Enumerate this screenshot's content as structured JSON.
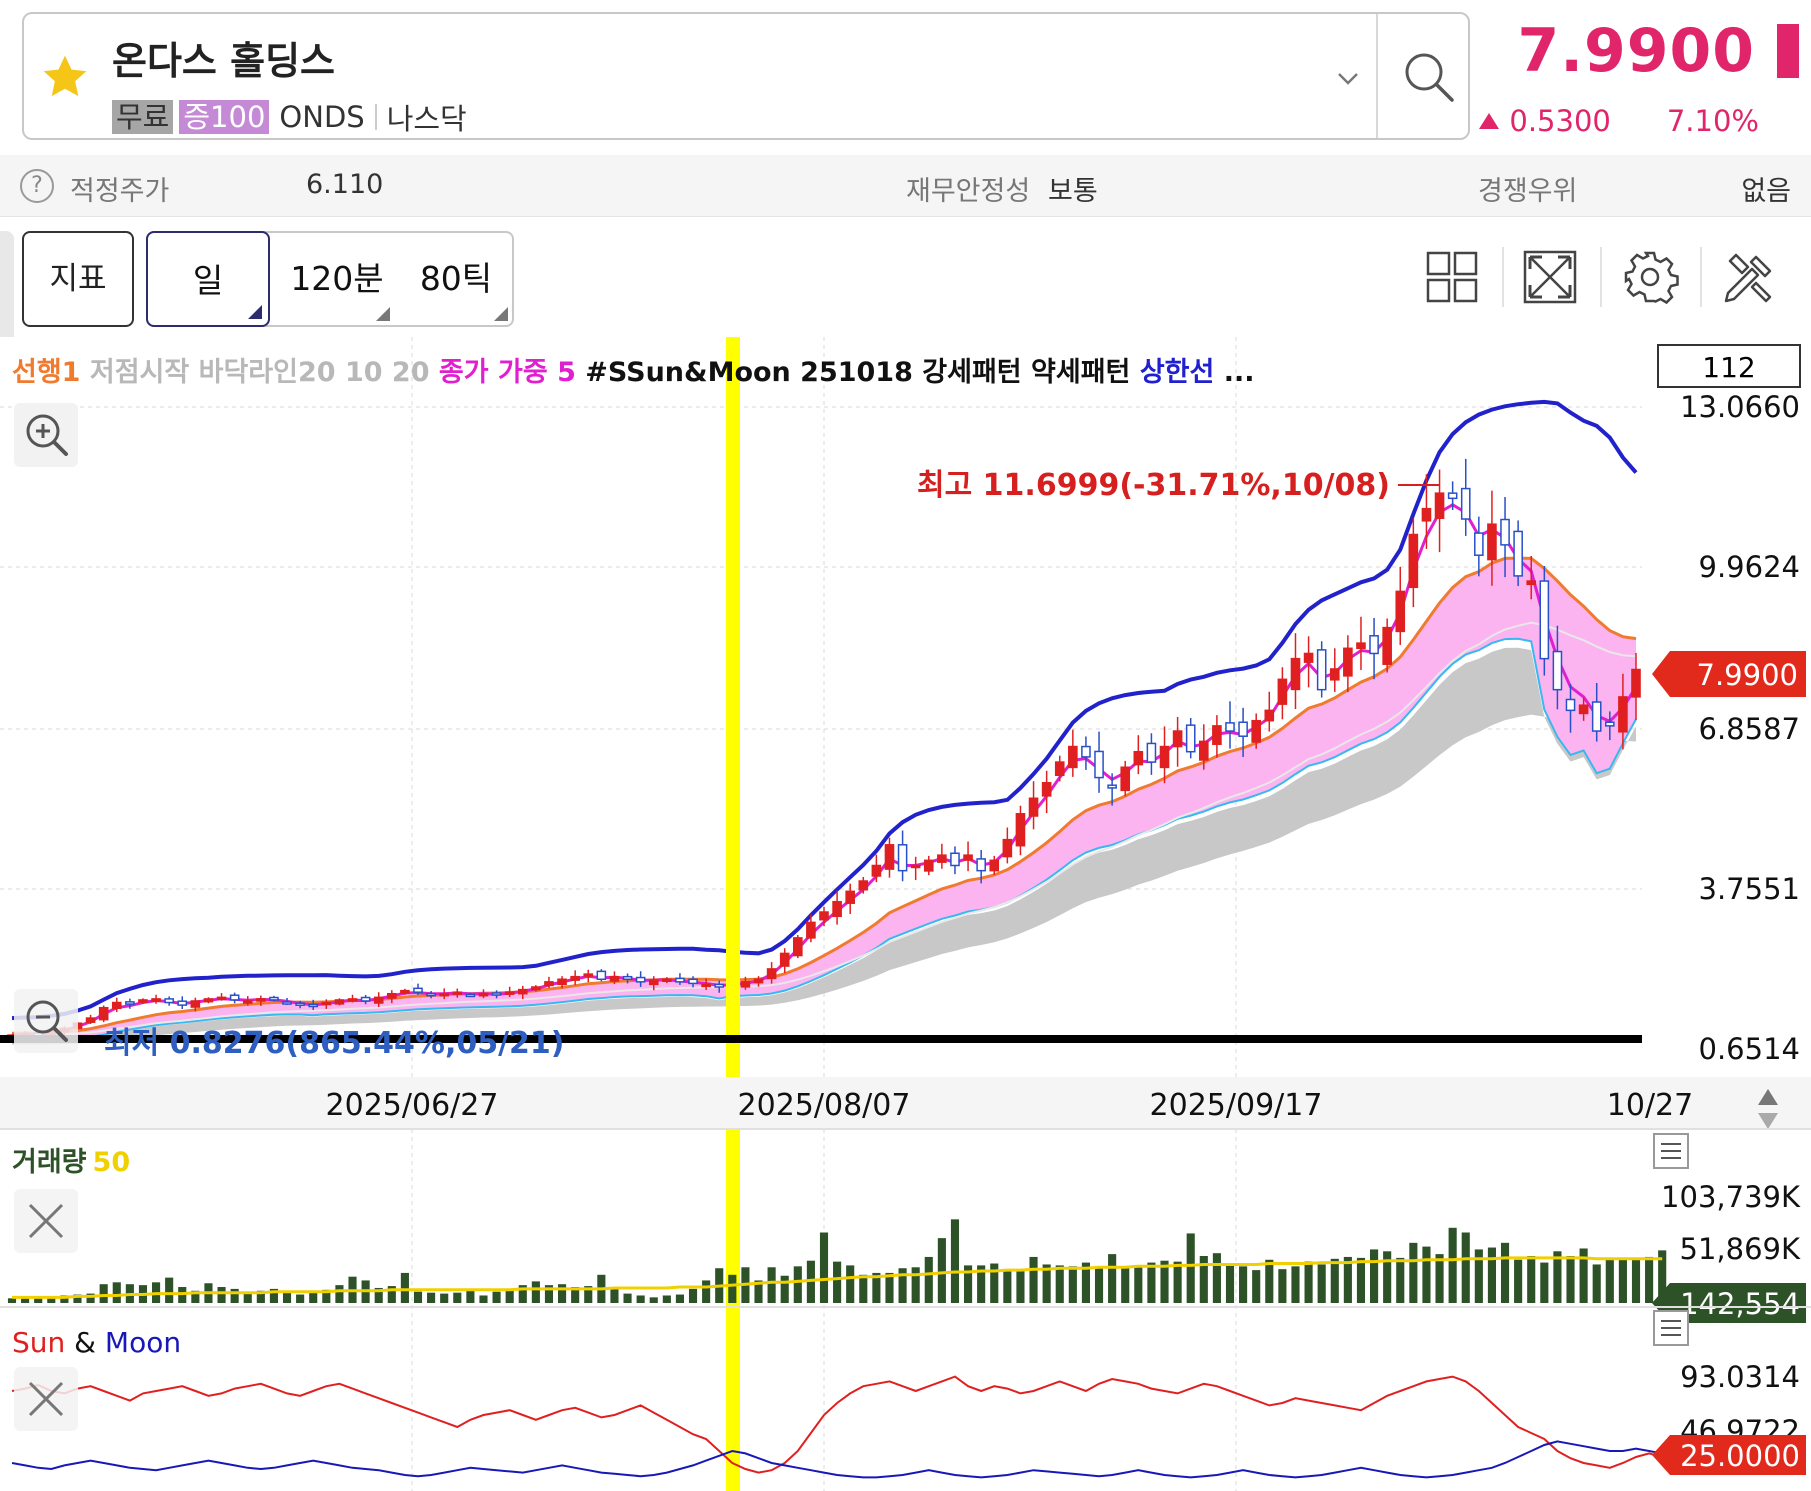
{
  "header": {
    "stock_name": "온다스 홀딩스",
    "tag_free": "무료",
    "tag_margin": "증100",
    "ticker": "ONDS",
    "exchange": "나스닥",
    "price": "7.9900",
    "change": "0.5300",
    "change_pct": "7.10%",
    "accent_color": "#e0256b"
  },
  "info_row": {
    "fair_price_label": "적정주가",
    "fair_price_value": "6.110",
    "financial_label": "재무안정성",
    "financial_value": "보통",
    "competitive_label": "경쟁우위",
    "competitive_value": "없음"
  },
  "toolbar": {
    "indicator_label": "지표",
    "periods": [
      "일",
      "120분",
      "80틱"
    ],
    "selected_period": "일"
  },
  "chart": {
    "legend": [
      {
        "text": "선행1",
        "color": "#f07a2e"
      },
      {
        "text": " 저점시작 바닥라인20 10 20 ",
        "color": "#b8b8b8"
      },
      {
        "text": "종가 가중 5 ",
        "color": "#e020d0"
      },
      {
        "text": "#SSun&Moon 251018 강세패턴 약세패턴 ",
        "color": "#111111"
      },
      {
        "text": "상한선",
        "color": "#2020d0"
      },
      {
        "text": " ...",
        "color": "#111111"
      }
    ],
    "count_box": "112",
    "y_labels": [
      "13.0660",
      "9.9624",
      "6.8587",
      "3.7551",
      "0.6514"
    ],
    "current_price_tag": "7.9900",
    "high_annotation": "최고 11.6999(-31.71%,10/08)",
    "low_annotation": "최저 0.8276(865.44%,05/21)",
    "x_labels": [
      "2025/06/27",
      "2025/08/07",
      "2025/09/17",
      "10/27"
    ],
    "volume_title": "거래량",
    "volume_ma_label": "50",
    "volume_y_labels": [
      "103,739K",
      "51,869K"
    ],
    "volume_current": "142,554",
    "osc_title_sun": "Sun",
    "osc_title_amp": " & ",
    "osc_title_moon": "Moon",
    "osc_y_labels": [
      "93.0314",
      "46.9722"
    ],
    "osc_current": "25.0000"
  },
  "chart_data": {
    "type": "candlestick",
    "x_labels": [
      "2025/06/27",
      "2025/08/07",
      "2025/09/17",
      "10/27"
    ],
    "y_ticks": [
      13.066,
      9.9624,
      6.8587,
      3.7551,
      0.6514
    ],
    "ylim": [
      0.6514,
      13.066
    ],
    "high": {
      "value": 11.6999,
      "date": "10/08",
      "pct": "-31.71%"
    },
    "low": {
      "value": 0.8276,
      "date": "05/21",
      "pct": "865.44%"
    },
    "last_close": 7.99,
    "close_series": [
      0.92,
      0.95,
      0.9,
      1.0,
      1.05,
      1.15,
      1.25,
      1.45,
      1.55,
      1.52,
      1.6,
      1.62,
      1.55,
      1.5,
      1.58,
      1.62,
      1.65,
      1.6,
      1.58,
      1.62,
      1.6,
      1.55,
      1.5,
      1.48,
      1.55,
      1.6,
      1.62,
      1.58,
      1.65,
      1.72,
      1.78,
      1.75,
      1.7,
      1.72,
      1.75,
      1.7,
      1.72,
      1.7,
      1.75,
      1.8,
      1.85,
      1.95,
      2.0,
      2.05,
      2.1,
      2.0,
      2.05,
      2.0,
      1.95,
      1.98,
      2.0,
      1.95,
      1.92,
      1.9,
      1.85,
      1.9,
      1.95,
      2.0,
      2.2,
      2.5,
      2.8,
      3.1,
      3.3,
      3.5,
      3.7,
      3.9,
      4.2,
      4.6,
      4.1,
      4.2,
      4.3,
      4.4,
      4.2,
      4.4,
      4.1,
      4.3,
      4.7,
      5.2,
      5.5,
      5.8,
      6.2,
      6.5,
      6.3,
      5.9,
      5.7,
      6.1,
      6.4,
      6.2,
      6.5,
      6.8,
      6.4,
      6.6,
      6.9,
      6.8,
      6.7,
      7.0,
      7.2,
      7.8,
      8.2,
      8.3,
      7.6,
      8.0,
      8.4,
      8.5,
      8.3,
      8.8,
      9.5,
      10.6,
      11.1,
      11.4,
      11.3,
      10.9,
      10.2,
      10.8,
      10.4,
      9.8,
      9.7,
      8.2,
      7.6,
      7.2,
      7.3,
      6.8,
      6.9,
      7.46,
      7.99
    ],
    "volume_ylim": [
      0,
      103739
    ],
    "volume_series": [
      5,
      6,
      5,
      7,
      8,
      9,
      10,
      20,
      22,
      20,
      19,
      22,
      27,
      17,
      13,
      21,
      17,
      15,
      12,
      13,
      15,
      11,
      9,
      11,
      14,
      19,
      28,
      24,
      16,
      18,
      32,
      12,
      11,
      10,
      11,
      13,
      8,
      12,
      15,
      19,
      23,
      19,
      20,
      17,
      18,
      30,
      17,
      10,
      8,
      6,
      8,
      9,
      15,
      24,
      37,
      30,
      38,
      24,
      38,
      29,
      39,
      45,
      75,
      44,
      40,
      30,
      32,
      32,
      37,
      38,
      49,
      69,
      89,
      40,
      40,
      42,
      35,
      34,
      49,
      41,
      40,
      39,
      43,
      39,
      52,
      39,
      40,
      43,
      45,
      44,
      74,
      50,
      53,
      42,
      39,
      35,
      46,
      36,
      39,
      44,
      41,
      47,
      49,
      48,
      57,
      55,
      48,
      64,
      60,
      52,
      80,
      75,
      57,
      59,
      64,
      46,
      50,
      43,
      55,
      50,
      58,
      41,
      47,
      46,
      48,
      49,
      56
    ],
    "volume_ma_series": [
      6,
      6,
      6,
      6,
      6,
      7,
      7,
      8,
      8,
      9,
      9,
      10,
      10,
      10,
      11,
      11,
      11,
      11,
      11,
      11,
      12,
      12,
      12,
      12,
      12,
      13,
      13,
      13,
      13,
      14,
      14,
      14,
      14,
      14,
      14,
      14,
      14,
      14,
      14,
      15,
      15,
      15,
      15,
      15,
      15,
      15,
      16,
      16,
      16,
      16,
      16,
      17,
      17,
      17,
      18,
      19,
      20,
      21,
      22,
      22,
      23,
      24,
      25,
      26,
      27,
      28,
      28,
      29,
      30,
      30,
      31,
      32,
      33,
      33,
      34,
      34,
      35,
      35,
      36,
      36,
      37,
      37,
      37,
      38,
      38,
      38,
      39,
      39,
      39,
      40,
      40,
      41,
      41,
      41,
      41,
      41,
      42,
      42,
      42,
      42,
      43,
      43,
      43,
      44,
      44,
      45,
      45,
      45,
      46,
      46,
      46,
      47,
      47,
      47,
      48,
      48,
      48,
      48,
      48,
      48,
      48,
      47,
      47,
      47,
      47,
      47,
      47
    ],
    "osc_sun_series": [
      80,
      82,
      85,
      80,
      78,
      82,
      84,
      80,
      76,
      72,
      78,
      80,
      82,
      84,
      80,
      76,
      78,
      82,
      84,
      86,
      82,
      78,
      76,
      80,
      84,
      86,
      82,
      78,
      74,
      70,
      66,
      62,
      58,
      54,
      50,
      56,
      60,
      62,
      64,
      60,
      56,
      60,
      64,
      66,
      62,
      58,
      60,
      64,
      68,
      62,
      56,
      50,
      44,
      40,
      30,
      20,
      15,
      12,
      14,
      20,
      30,
      45,
      60,
      70,
      78,
      84,
      86,
      88,
      84,
      80,
      84,
      88,
      92,
      84,
      80,
      84,
      82,
      78,
      80,
      84,
      88,
      84,
      80,
      86,
      90,
      88,
      86,
      82,
      80,
      78,
      82,
      86,
      84,
      80,
      76,
      72,
      68,
      70,
      74,
      72,
      70,
      68,
      66,
      64,
      70,
      76,
      80,
      84,
      88,
      90,
      92,
      88,
      80,
      70,
      60,
      50,
      45,
      40,
      30,
      24,
      20,
      18,
      16,
      20,
      25,
      28,
      25
    ],
    "osc_moon_series": [
      20,
      18,
      16,
      15,
      18,
      20,
      22,
      20,
      18,
      16,
      15,
      14,
      16,
      18,
      20,
      22,
      20,
      18,
      16,
      15,
      16,
      18,
      20,
      22,
      20,
      18,
      16,
      15,
      14,
      12,
      10,
      9,
      10,
      12,
      14,
      16,
      15,
      14,
      13,
      12,
      14,
      16,
      18,
      16,
      14,
      12,
      11,
      10,
      9,
      10,
      12,
      15,
      18,
      22,
      26,
      30,
      28,
      24,
      20,
      18,
      16,
      14,
      12,
      10,
      9,
      8,
      8,
      9,
      10,
      12,
      14,
      12,
      10,
      9,
      8,
      9,
      10,
      12,
      14,
      13,
      12,
      11,
      10,
      9,
      10,
      12,
      14,
      12,
      10,
      9,
      8,
      9,
      10,
      12,
      14,
      12,
      10,
      9,
      8,
      9,
      10,
      12,
      14,
      16,
      14,
      12,
      10,
      9,
      8,
      9,
      10,
      12,
      14,
      16,
      20,
      25,
      30,
      35,
      38,
      36,
      34,
      32,
      30,
      30,
      32,
      30,
      28
    ]
  },
  "colors": {
    "up_candle": "#e02020",
    "down_candle": "#2850c8",
    "upper_band": "#2222cc",
    "ma5": "#e020d0",
    "cloud": "#fcb4f0",
    "orange_line": "#f07a2e",
    "gray_band": "#c8c8c8",
    "cyan_line": "#38b8f0",
    "volume_bar": "#2e5228",
    "volume_ma": "#f0d000",
    "sun_line": "#e02020",
    "moon_line": "#1818b8",
    "marker_yellow": "#ffff00"
  }
}
